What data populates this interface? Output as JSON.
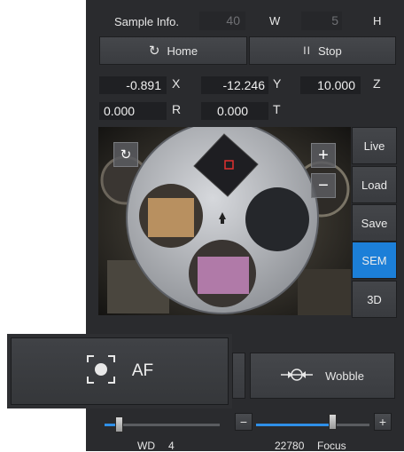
{
  "header": {
    "sample_info_label": "Sample Info.",
    "width_value": "40",
    "width_unit": "W",
    "height_value": "5",
    "height_unit": "H"
  },
  "toolbar": {
    "home_label": "Home",
    "stop_label": "Stop"
  },
  "coords": {
    "x_value": "-0.891",
    "x_label": "X",
    "y_value": "-12.246",
    "y_label": "Y",
    "z_value": "10.000",
    "z_label": "Z",
    "r_value": "0.000",
    "r_label": "R",
    "t_value": "0.000",
    "t_label": "T"
  },
  "camera": {
    "zoom_in_label": "+",
    "zoom_out_label": "−"
  },
  "side_buttons": [
    {
      "label": "Live",
      "active": false
    },
    {
      "label": "Load",
      "active": false
    },
    {
      "label": "Save",
      "active": false
    },
    {
      "label": "SEM",
      "active": true
    },
    {
      "label": "3D",
      "active": false
    }
  ],
  "actions": {
    "af_label": "AF",
    "wobble_label": "Wobble"
  },
  "sliders": {
    "wd_label": "WD",
    "wd_value": "4",
    "focus_value": "22780",
    "focus_label": "Focus",
    "focus_minus": "−",
    "focus_plus": "+",
    "wd_level": 0.12,
    "focus_level": 0.67
  },
  "colors": {
    "accent": "#1c7fd8",
    "panel": "#2a2b2e"
  }
}
